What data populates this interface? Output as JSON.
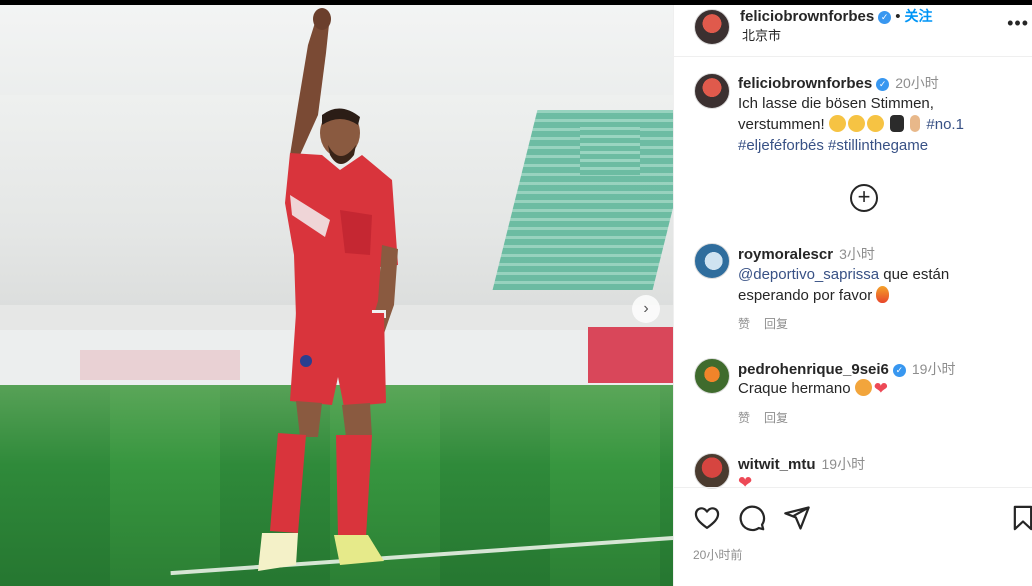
{
  "post": {
    "author": "feliciobrownforbes",
    "follow_label": "关注",
    "location": "北京市",
    "caption_author": "feliciobrownforbes",
    "caption_time": "20小时",
    "caption_line1": "Ich lasse die bösen Stimmen,",
    "caption_line2": "verstummen!",
    "caption_tag_no1": "#no.1",
    "caption_tags": "#eljeféforbés #stillinthegame",
    "date": "20小时前"
  },
  "comments": [
    {
      "user": "roymoralescr",
      "time": "3小时",
      "mention": "@deportivo_saprissa",
      "text1": " que están",
      "text2": "esperando por favor",
      "like_label": "赞",
      "reply_label": "回复"
    },
    {
      "user": "pedrohenrique_9sei6",
      "time": "19小时",
      "text1": "Craque hermano",
      "like_label": "赞",
      "reply_label": "回复"
    },
    {
      "user": "witwit_mtu",
      "time": "19小时"
    }
  ],
  "icons": {
    "verified": "verified-badge-icon",
    "more": "more-options-icon",
    "load_more": "plus-circle-icon",
    "like": "heart-outline-icon",
    "comment": "comment-bubble-icon",
    "share": "paper-plane-icon",
    "save": "bookmark-icon",
    "carousel_next": "chevron-right-icon"
  },
  "colors": {
    "link": "#0095f6",
    "hashtag": "#385185",
    "verified": "#3897f0",
    "muted": "#8e8e8e",
    "jersey": "#d9343c"
  }
}
